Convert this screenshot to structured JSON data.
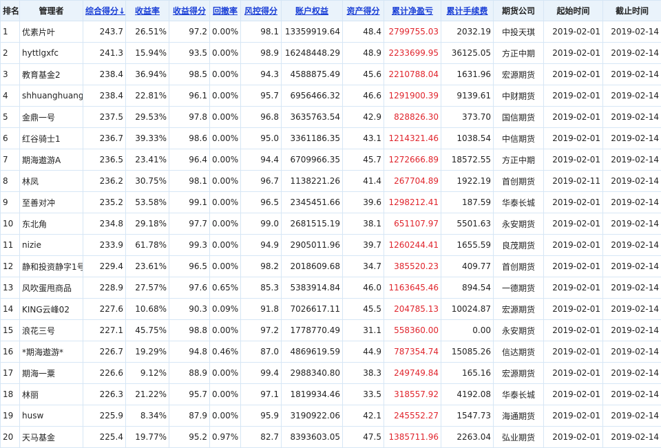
{
  "headers": [
    {
      "label": "排名",
      "sortable": false,
      "name": "header-rank"
    },
    {
      "label": "管理者",
      "sortable": false,
      "name": "header-manager"
    },
    {
      "label": "综合得分↓",
      "sortable": true,
      "name": "header-overall-score"
    },
    {
      "label": "收益率",
      "sortable": true,
      "name": "header-return-rate"
    },
    {
      "label": "收益得分",
      "sortable": true,
      "name": "header-return-score"
    },
    {
      "label": "回撤率",
      "sortable": true,
      "name": "header-drawdown"
    },
    {
      "label": "风控得分",
      "sortable": true,
      "name": "header-risk-score"
    },
    {
      "label": "账户权益",
      "sortable": true,
      "name": "header-equity"
    },
    {
      "label": "资产得分",
      "sortable": true,
      "name": "header-asset-score"
    },
    {
      "label": "累计净盈亏",
      "sortable": true,
      "name": "header-net-pnl"
    },
    {
      "label": "累计手续费",
      "sortable": true,
      "name": "header-fees"
    },
    {
      "label": "期货公司",
      "sortable": false,
      "name": "header-broker"
    },
    {
      "label": "起始时间",
      "sortable": false,
      "name": "header-start"
    },
    {
      "label": "截止时间",
      "sortable": false,
      "name": "header-end"
    }
  ],
  "colors": {
    "accent_link": "#1a3fd6",
    "profit_red": "#e0242c",
    "header_bg": "#eaf3fb",
    "border": "#d6e6f5"
  },
  "rows": [
    [
      "1",
      "优素片叶",
      "243.7",
      "26.51%",
      "97.2",
      "0.00%",
      "98.1",
      "13359919.64",
      "48.4",
      "2799755.03",
      "2032.19",
      "中投天琪",
      "2019-02-01",
      "2019-02-14"
    ],
    [
      "2",
      "hyttlgxfc",
      "241.3",
      "15.94%",
      "93.5",
      "0.00%",
      "98.9",
      "16248448.29",
      "48.9",
      "2233699.95",
      "36125.05",
      "方正中期",
      "2019-02-01",
      "2019-02-14"
    ],
    [
      "3",
      "教育基金2",
      "238.4",
      "36.94%",
      "98.5",
      "0.00%",
      "94.3",
      "4588875.49",
      "45.6",
      "2210788.04",
      "1631.96",
      "宏源期货",
      "2019-02-01",
      "2019-02-14"
    ],
    [
      "4",
      "shhuanghuang",
      "238.4",
      "22.81%",
      "96.1",
      "0.00%",
      "95.7",
      "6956466.32",
      "46.6",
      "1291900.39",
      "9139.61",
      "中财期货",
      "2019-02-01",
      "2019-02-14"
    ],
    [
      "5",
      "金鼎一号",
      "237.5",
      "29.53%",
      "97.8",
      "0.00%",
      "96.8",
      "3635763.54",
      "42.9",
      "828826.30",
      "373.70",
      "国信期货",
      "2019-02-01",
      "2019-02-14"
    ],
    [
      "6",
      "红谷骑士1",
      "236.7",
      "39.33%",
      "98.6",
      "0.00%",
      "95.0",
      "3361186.35",
      "43.1",
      "1214321.46",
      "1038.54",
      "中信期货",
      "2019-02-01",
      "2019-02-14"
    ],
    [
      "7",
      "期海遨游A",
      "236.5",
      "23.41%",
      "96.4",
      "0.00%",
      "94.4",
      "6709966.35",
      "45.7",
      "1272666.89",
      "18572.55",
      "方正中期",
      "2019-02-01",
      "2019-02-14"
    ],
    [
      "8",
      "林凤",
      "236.2",
      "30.75%",
      "98.1",
      "0.00%",
      "96.7",
      "1138221.26",
      "41.4",
      "267704.89",
      "1922.19",
      "首创期货",
      "2019-02-11",
      "2019-02-14"
    ],
    [
      "9",
      "至善对冲",
      "235.2",
      "53.58%",
      "99.1",
      "0.00%",
      "96.5",
      "2345451.66",
      "39.6",
      "1298212.41",
      "187.59",
      "华泰长城",
      "2019-02-01",
      "2019-02-14"
    ],
    [
      "10",
      "东北角",
      "234.8",
      "29.18%",
      "97.7",
      "0.00%",
      "99.0",
      "2681515.19",
      "38.1",
      "651107.97",
      "5501.63",
      "永安期货",
      "2019-02-01",
      "2019-02-14"
    ],
    [
      "11",
      "nizie",
      "233.9",
      "61.78%",
      "99.3",
      "0.00%",
      "94.9",
      "2905011.96",
      "39.7",
      "1260244.41",
      "1655.59",
      "良茂期货",
      "2019-02-01",
      "2019-02-14"
    ],
    [
      "12",
      "静和投资静字1号",
      "229.4",
      "23.61%",
      "96.5",
      "0.00%",
      "98.2",
      "2018609.68",
      "34.7",
      "385520.23",
      "409.77",
      "首创期货",
      "2019-02-01",
      "2019-02-14"
    ],
    [
      "13",
      "风吹蛋甩商品",
      "228.9",
      "27.57%",
      "97.6",
      "0.65%",
      "85.3",
      "5383914.84",
      "46.0",
      "1163645.46",
      "894.54",
      "一德期货",
      "2019-02-01",
      "2019-02-14"
    ],
    [
      "14",
      "KING云峰02",
      "227.6",
      "10.68%",
      "90.3",
      "0.09%",
      "91.8",
      "7026617.11",
      "45.5",
      "204785.13",
      "10024.87",
      "宏源期货",
      "2019-02-01",
      "2019-02-14"
    ],
    [
      "15",
      "浪花三号",
      "227.1",
      "45.75%",
      "98.8",
      "0.00%",
      "97.2",
      "1778770.49",
      "31.1",
      "558360.00",
      "0.00",
      "永安期货",
      "2019-02-01",
      "2019-02-14"
    ],
    [
      "16",
      "*期海遨游*",
      "226.7",
      "19.29%",
      "94.8",
      "0.46%",
      "87.0",
      "4869619.59",
      "44.9",
      "787354.74",
      "15085.26",
      "信达期货",
      "2019-02-01",
      "2019-02-14"
    ],
    [
      "17",
      "期海一粟",
      "226.6",
      "9.12%",
      "88.9",
      "0.00%",
      "99.4",
      "2988340.80",
      "38.3",
      "249749.84",
      "165.16",
      "宏源期货",
      "2019-02-01",
      "2019-02-14"
    ],
    [
      "18",
      "林丽",
      "226.3",
      "21.22%",
      "95.7",
      "0.00%",
      "97.1",
      "1819934.46",
      "33.5",
      "318557.92",
      "4192.08",
      "华泰长城",
      "2019-02-01",
      "2019-02-14"
    ],
    [
      "19",
      "husw",
      "225.9",
      "8.34%",
      "87.9",
      "0.00%",
      "95.9",
      "3190922.06",
      "42.1",
      "245552.27",
      "1547.73",
      "海通期货",
      "2019-02-01",
      "2019-02-14"
    ],
    [
      "20",
      "天马基金",
      "225.4",
      "19.77%",
      "95.2",
      "0.97%",
      "82.7",
      "8393603.05",
      "47.5",
      "1385711.96",
      "2263.04",
      "弘业期货",
      "2019-02-01",
      "2019-02-14"
    ]
  ]
}
